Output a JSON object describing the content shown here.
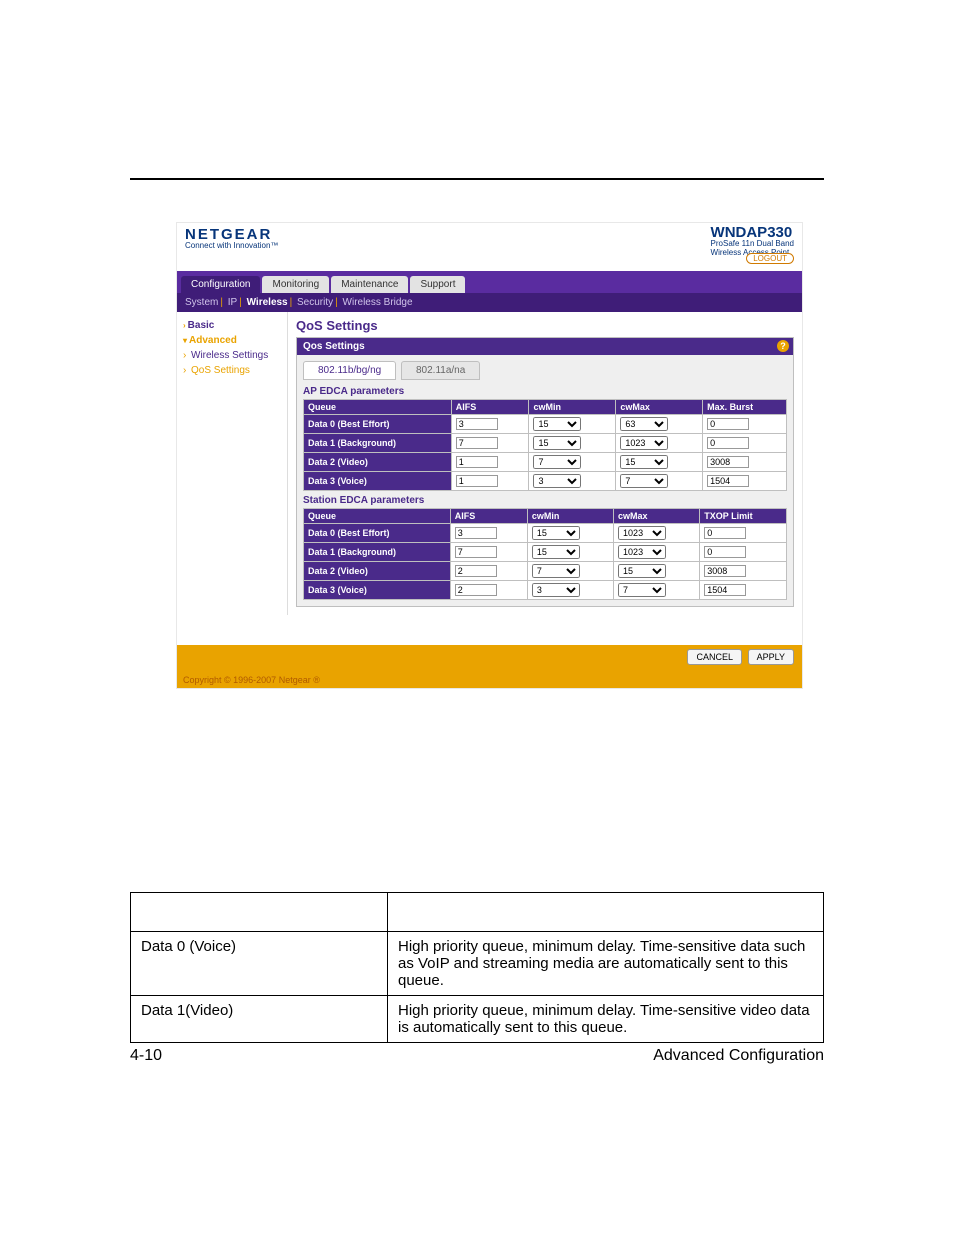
{
  "brand": "NETGEAR",
  "tagline": "Connect with Innovation™",
  "model": "WNDAP330",
  "model_sub1": "ProSafe 11n Dual Band",
  "model_sub2": "Wireless Access Point",
  "logout": "LOGOUT",
  "tabs": [
    "Configuration",
    "Monitoring",
    "Maintenance",
    "Support"
  ],
  "subnav": [
    "System",
    "IP",
    "Wireless",
    "Security",
    "Wireless Bridge"
  ],
  "side": {
    "basic": "Basic",
    "advanced": "Advanced",
    "wireless_settings": "Wireless Settings",
    "qos_settings": "QoS Settings"
  },
  "panel_title": "QoS Settings",
  "panel_header": "Qos Settings",
  "radio_tabs": [
    "802.11b/bg/ng",
    "802.11a/na"
  ],
  "ap_label": "AP EDCA parameters",
  "station_label": "Station EDCA parameters",
  "ap": {
    "headers": [
      "Queue",
      "AIFS",
      "cwMin",
      "cwMax",
      "Max. Burst"
    ],
    "rows": [
      {
        "q": "Data 0 (Best Effort)",
        "aifs": "3",
        "cwmin": "15",
        "cwmax": "63",
        "last": "0"
      },
      {
        "q": "Data 1 (Background)",
        "aifs": "7",
        "cwmin": "15",
        "cwmax": "1023",
        "last": "0"
      },
      {
        "q": "Data 2 (Video)",
        "aifs": "1",
        "cwmin": "7",
        "cwmax": "15",
        "last": "3008"
      },
      {
        "q": "Data 3 (Voice)",
        "aifs": "1",
        "cwmin": "3",
        "cwmax": "7",
        "last": "1504"
      }
    ]
  },
  "st": {
    "headers": [
      "Queue",
      "AIFS",
      "cwMin",
      "cwMax",
      "TXOP Limit"
    ],
    "rows": [
      {
        "q": "Data 0 (Best Effort)",
        "aifs": "3",
        "cwmin": "15",
        "cwmax": "1023",
        "last": "0"
      },
      {
        "q": "Data 1 (Background)",
        "aifs": "7",
        "cwmin": "15",
        "cwmax": "1023",
        "last": "0"
      },
      {
        "q": "Data 2 (Video)",
        "aifs": "2",
        "cwmin": "7",
        "cwmax": "15",
        "last": "3008"
      },
      {
        "q": "Data 3 (Voice)",
        "aifs": "2",
        "cwmin": "3",
        "cwmax": "7",
        "last": "1504"
      }
    ]
  },
  "buttons": {
    "cancel": "CANCEL",
    "apply": "APPLY"
  },
  "copyright": "Copyright © 1996-2007 Netgear ®",
  "desc_rows": [
    {
      "c1": "Data 0 (Voice)",
      "c2": "High priority queue, minimum delay. Time-sensitive data such as VoIP and streaming media are automatically sent to this queue."
    },
    {
      "c1": "Data 1(Video)",
      "c2": "High priority queue, minimum delay. Time-sensitive video data is automatically sent to this queue."
    }
  ],
  "footer": {
    "left": "4-10",
    "right": "Advanced Configuration"
  }
}
